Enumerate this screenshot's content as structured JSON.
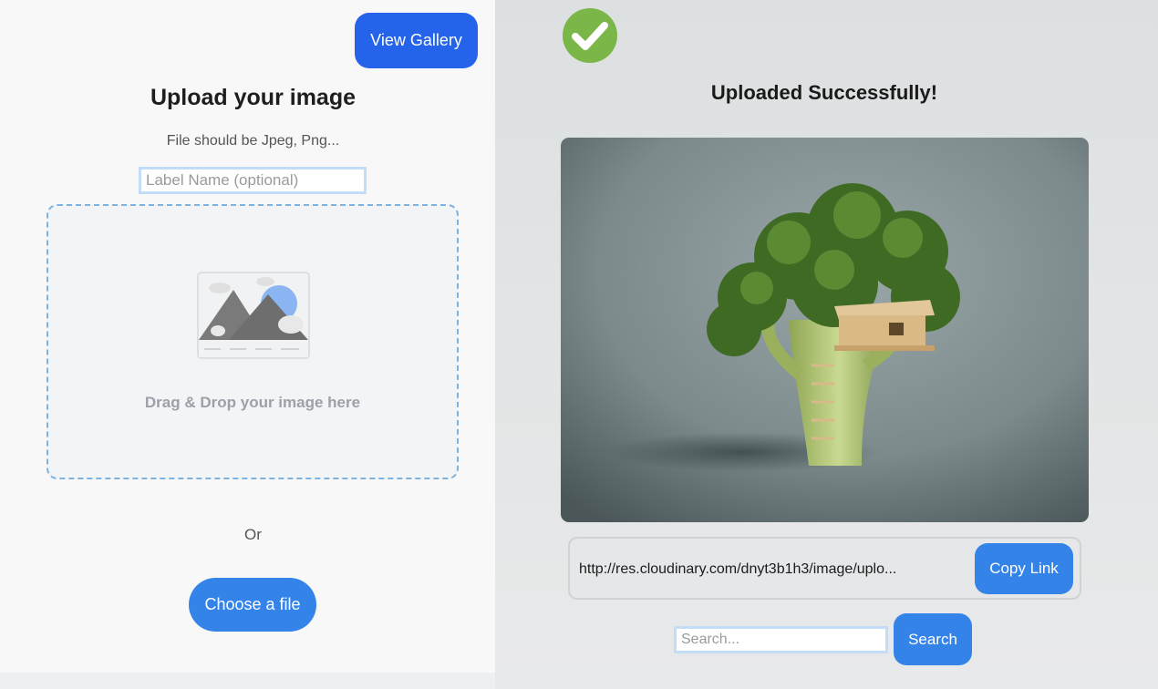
{
  "upload_panel": {
    "view_gallery_label": "View Gallery",
    "title": "Upload your image",
    "subtitle": "File should be Jpeg, Png...",
    "label_placeholder": "Label Name (optional)",
    "dropzone_text": "Drag & Drop your image here",
    "dropzone_icon": "image-placeholder-icon",
    "or_text": "Or",
    "choose_label": "Choose a file"
  },
  "result_panel": {
    "success_icon": "checkmark-circle-icon",
    "title": "Uploaded Successfully!",
    "preview_subject": "broccoli-treehouse-photo",
    "link": "http://res.cloudinary.com/dnyt3b1h3/image/uplo...",
    "copy_label": "Copy Link",
    "search_placeholder": "Search...",
    "search_label": "Search"
  },
  "colors": {
    "primary_button": "#2563eb",
    "secondary_button": "#3483e8",
    "success_green": "#7ab648",
    "dropzone_border": "#7cb2e0",
    "input_border": "#c3dcf7"
  }
}
